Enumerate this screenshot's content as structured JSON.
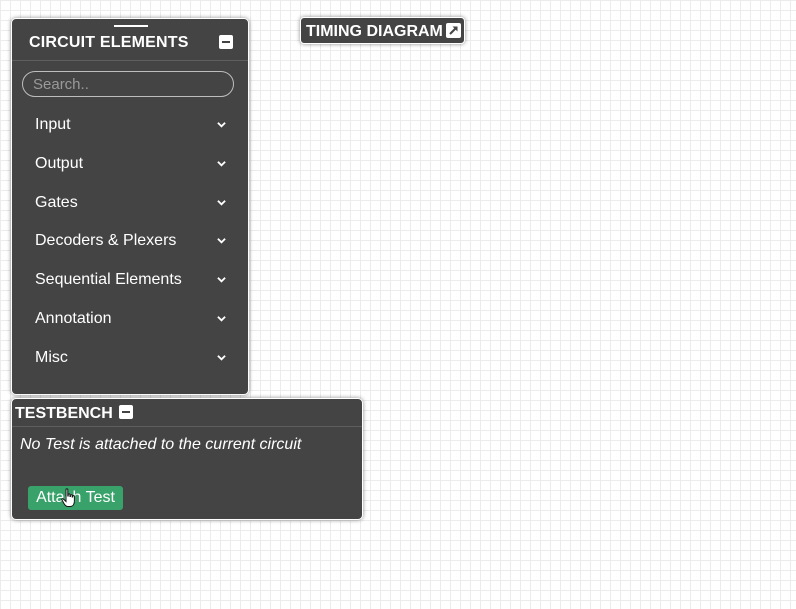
{
  "circuit_panel": {
    "title": "CIRCUIT ELEMENTS",
    "search": {
      "placeholder": "Search..",
      "value": ""
    },
    "categories": [
      {
        "label": "Input"
      },
      {
        "label": "Output"
      },
      {
        "label": "Gates"
      },
      {
        "label": "Decoders & Plexers"
      },
      {
        "label": "Sequential Elements"
      },
      {
        "label": "Annotation"
      },
      {
        "label": "Misc"
      }
    ],
    "icons": {
      "minimize": "minimize-icon",
      "expand": "chevron-down-icon"
    }
  },
  "testbench_panel": {
    "title": "TESTBENCH",
    "message": "No Test is attached to the current circuit",
    "attach_label": "Attach Test",
    "attach_color": "#39a26a"
  },
  "timing_diagram": {
    "label": "TIMING DIAGRAM",
    "icon": "external-link-icon"
  },
  "colors": {
    "panel_bg": "#444444",
    "canvas_grid": "#ececec"
  }
}
